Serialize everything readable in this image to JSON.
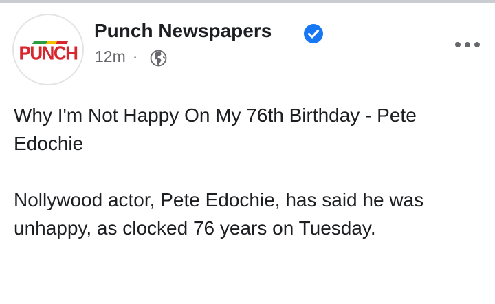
{
  "post": {
    "page_name": "Punch Newspapers",
    "timestamp": "12m",
    "separator": "·",
    "audience_icon": "globe-icon",
    "verified_icon": "verified-badge-icon",
    "more_icon": "more-horizontal-icon",
    "avatar": {
      "logo_text": "PUNCH",
      "colors": {
        "text": "#d8262f",
        "bar_green": "#2a9d44",
        "bar_yellow": "#f2c200",
        "bar_red": "#d8262f"
      }
    },
    "body": {
      "headline": "Why I'm Not Happy On My 76th Birthday - Pete Edochie",
      "paragraph_1": "Nollywood actor, Pete Edochie, has said he was unhappy, as clocked 76 years on Tuesday."
    }
  },
  "colors": {
    "verified_blue": "#1877f2",
    "meta_gray": "#65676b",
    "text": "#1c1e21"
  }
}
